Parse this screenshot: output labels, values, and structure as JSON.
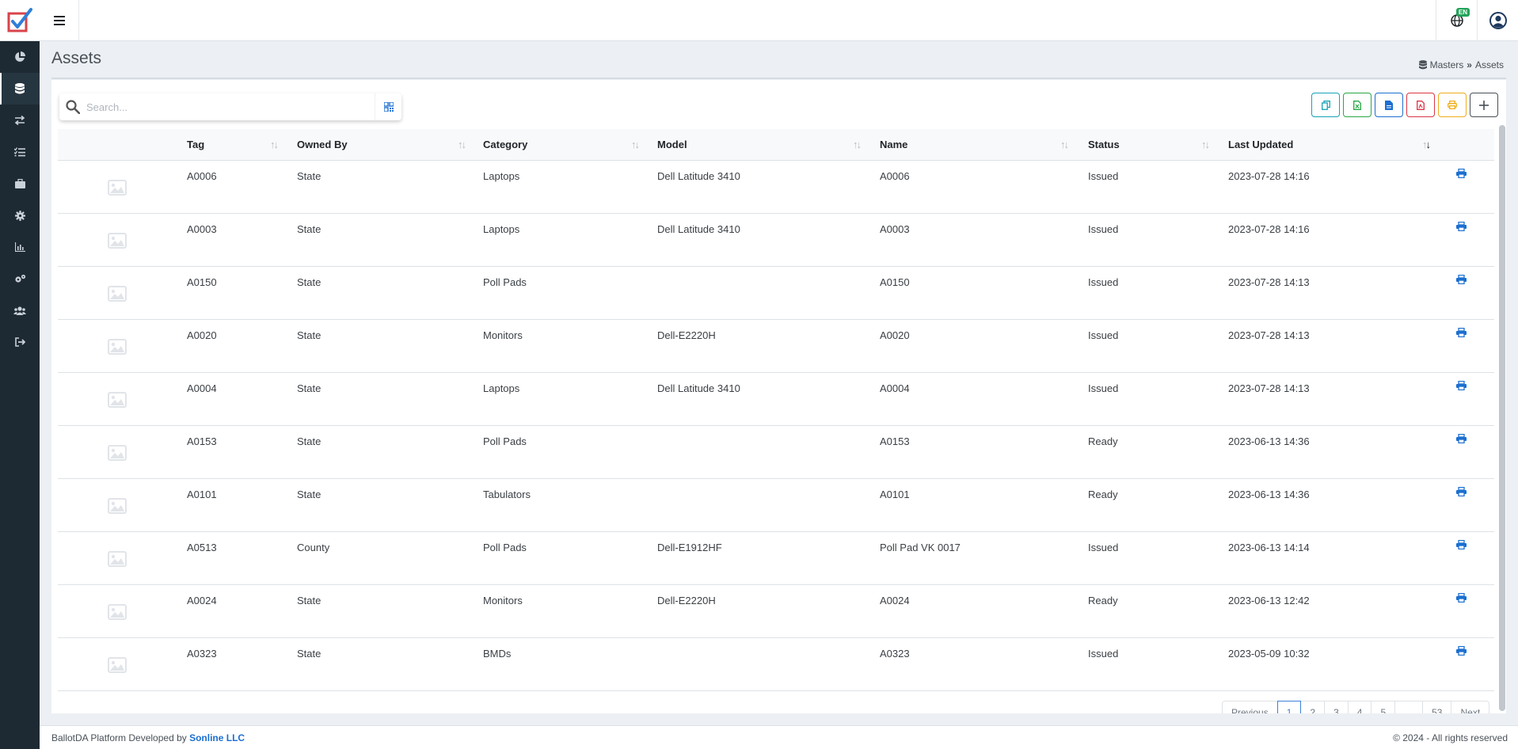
{
  "app": {
    "logo_icon": "checkbox-logo-icon",
    "accent_color": "#3b82d9",
    "sidebar_bg": "#1e2a33"
  },
  "sidebar": {
    "items": [
      {
        "name": "dashboard",
        "icon": "pie-chart-icon"
      },
      {
        "name": "masters",
        "icon": "database-icon",
        "active": true
      },
      {
        "name": "transfers",
        "icon": "exchange-icon"
      },
      {
        "name": "tasks",
        "icon": "checklist-icon"
      },
      {
        "name": "inventory",
        "icon": "briefcase-icon"
      },
      {
        "name": "settings",
        "icon": "gear-icon"
      },
      {
        "name": "reports",
        "icon": "bar-chart-icon"
      },
      {
        "name": "configuration",
        "icon": "gears-icon"
      },
      {
        "name": "users",
        "icon": "users-icon"
      },
      {
        "name": "logout",
        "icon": "sign-out-icon"
      }
    ]
  },
  "topbar": {
    "language_badge": "EN"
  },
  "page": {
    "title": "Assets",
    "breadcrumb": [
      "Masters",
      "Assets"
    ]
  },
  "search": {
    "placeholder": "Search..."
  },
  "toolbar": {
    "buttons": [
      {
        "name": "copy",
        "color": "#17a2b8"
      },
      {
        "name": "excel",
        "color": "#28a745"
      },
      {
        "name": "csv",
        "color": "#1b6fd1"
      },
      {
        "name": "pdf",
        "color": "#dc3545"
      },
      {
        "name": "print",
        "color": "#f0ad1a"
      },
      {
        "name": "add",
        "color": "#495057"
      }
    ]
  },
  "table": {
    "columns": [
      "Tag",
      "Owned By",
      "Category",
      "Model",
      "Name",
      "Status",
      "Last Updated"
    ],
    "rows": [
      {
        "tag": "A0006",
        "owned_by": "State",
        "category": "Laptops",
        "model": "Dell Latitude 3410",
        "name": "A0006",
        "status": "Issued",
        "updated": "2023-07-28 14:16"
      },
      {
        "tag": "A0003",
        "owned_by": "State",
        "category": "Laptops",
        "model": "Dell Latitude 3410",
        "name": "A0003",
        "status": "Issued",
        "updated": "2023-07-28 14:16"
      },
      {
        "tag": "A0150",
        "owned_by": "State",
        "category": "Poll Pads",
        "model": "",
        "name": "A0150",
        "status": "Issued",
        "updated": "2023-07-28 14:13"
      },
      {
        "tag": "A0020",
        "owned_by": "State",
        "category": "Monitors",
        "model": "Dell-E2220H",
        "name": "A0020",
        "status": "Issued",
        "updated": "2023-07-28 14:13"
      },
      {
        "tag": "A0004",
        "owned_by": "State",
        "category": "Laptops",
        "model": "Dell Latitude 3410",
        "name": "A0004",
        "status": "Issued",
        "updated": "2023-07-28 14:13"
      },
      {
        "tag": "A0153",
        "owned_by": "State",
        "category": "Poll Pads",
        "model": "",
        "name": "A0153",
        "status": "Ready",
        "updated": "2023-06-13 14:36"
      },
      {
        "tag": "A0101",
        "owned_by": "State",
        "category": "Tabulators",
        "model": "",
        "name": "A0101",
        "status": "Ready",
        "updated": "2023-06-13 14:36"
      },
      {
        "tag": "A0513",
        "owned_by": "County",
        "category": "Poll Pads",
        "model": "Dell-E1912HF",
        "name": "Poll Pad VK 0017",
        "status": "Issued",
        "updated": "2023-06-13 14:14"
      },
      {
        "tag": "A0024",
        "owned_by": "State",
        "category": "Monitors",
        "model": "Dell-E2220H",
        "name": "A0024",
        "status": "Ready",
        "updated": "2023-06-13 12:42"
      },
      {
        "tag": "A0323",
        "owned_by": "State",
        "category": "BMDs",
        "model": "",
        "name": "A0323",
        "status": "Issued",
        "updated": "2023-05-09 10:32"
      }
    ]
  },
  "pagination": {
    "items": [
      "Previous",
      "1",
      "2",
      "3",
      "4",
      "5",
      "…",
      "53",
      "Next"
    ],
    "active": "1"
  },
  "footer": {
    "left_text": "BallotDA Platform Developed by ",
    "brand": "Sonline LLC",
    "right_text": "© 2024 - All rights reserved"
  }
}
